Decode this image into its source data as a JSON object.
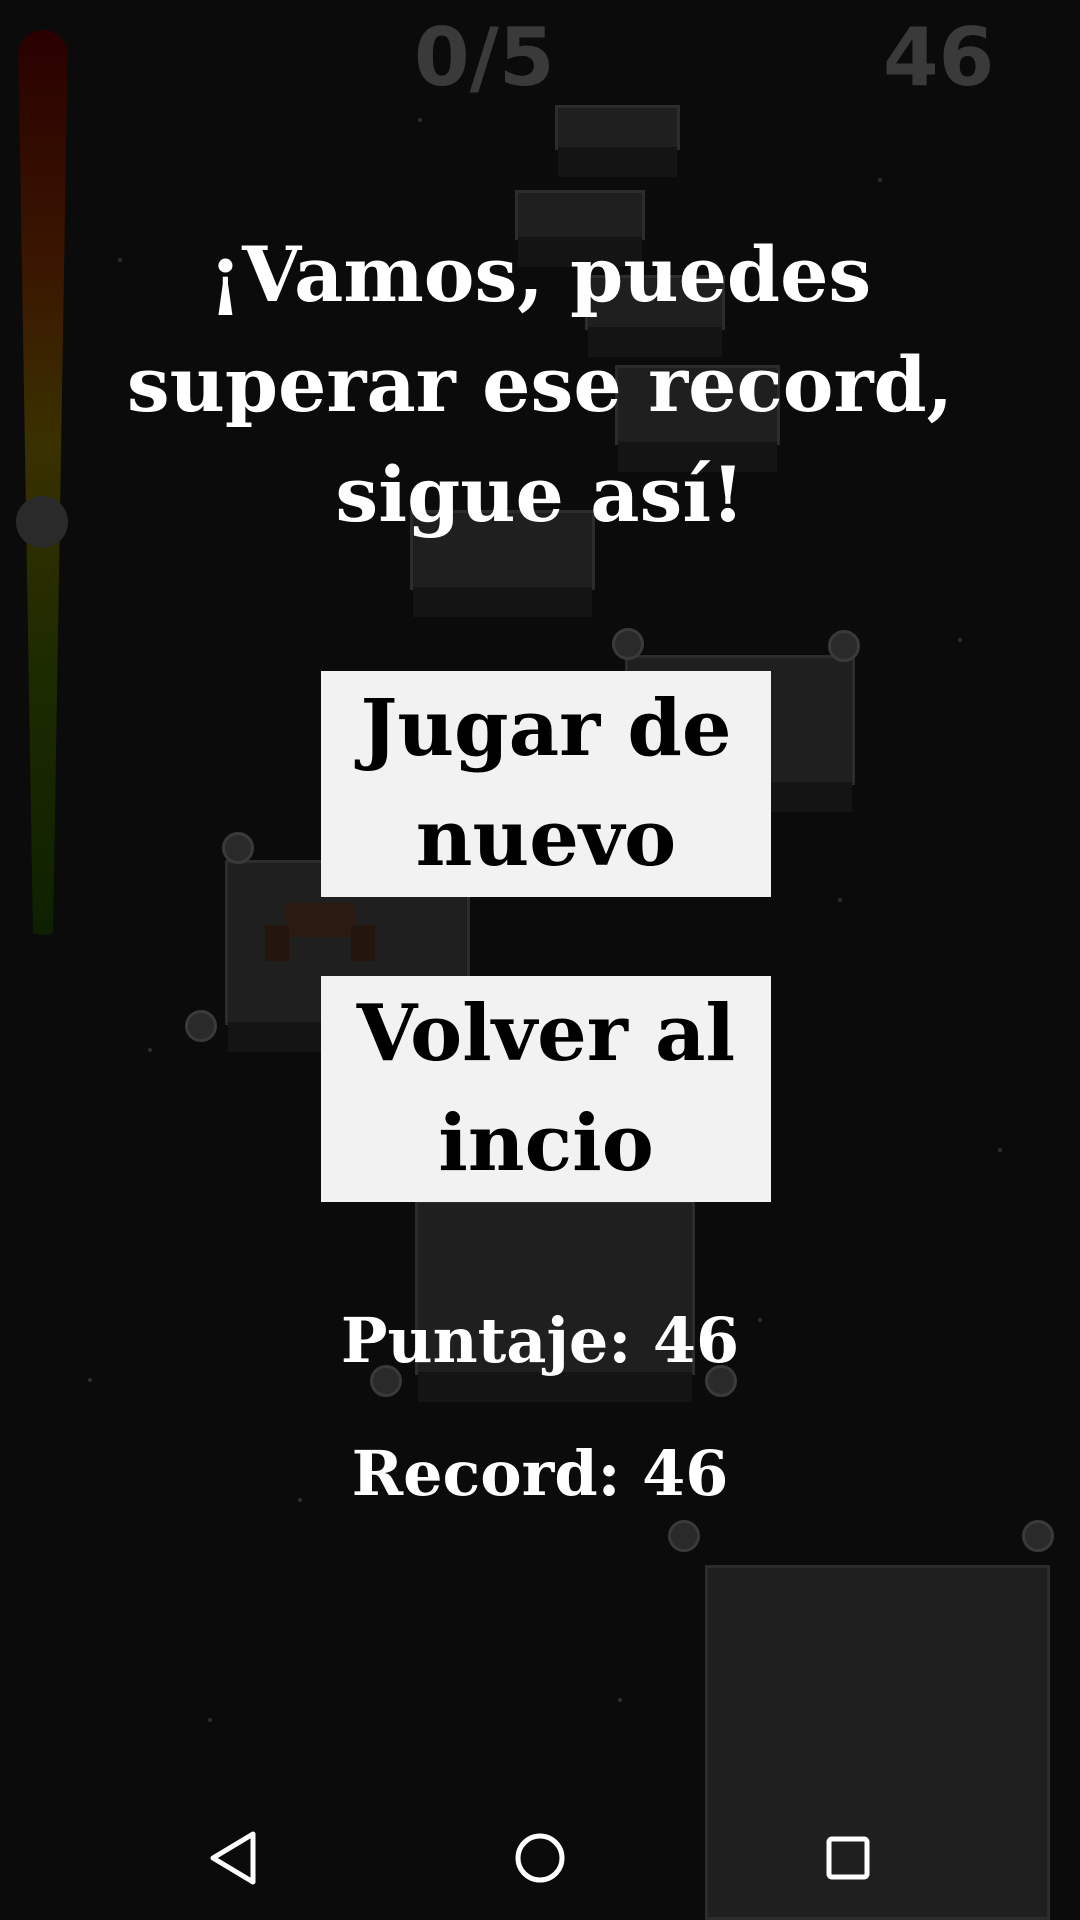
{
  "hud": {
    "progress": "0/5",
    "score": "46"
  },
  "headline": "¡Vamos, puedes superar ese record, sigue así!",
  "buttons": {
    "play_again": "Jugar de nuevo",
    "back_home": "Volver al incio"
  },
  "stats": {
    "score_label": "Puntaje: 46",
    "record_label": "Record: 46"
  },
  "navbar": {
    "icons": [
      "back-triangle-icon",
      "home-circle-icon",
      "recents-square-icon"
    ]
  },
  "colors": {
    "background": "#0b0b0b",
    "button_bg": "#f2f2f2",
    "text": "#ffffff",
    "hud_text": "#3a3a3a"
  }
}
